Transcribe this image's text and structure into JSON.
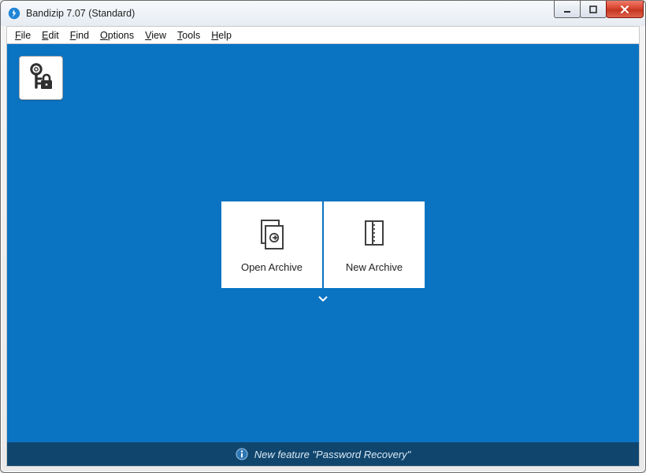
{
  "title": "Bandizip 7.07 (Standard)",
  "menu": {
    "file": {
      "mn": "F",
      "rest": "ile"
    },
    "edit": {
      "mn": "E",
      "rest": "dit"
    },
    "find": {
      "mn": "F",
      "rest": "ind"
    },
    "options": {
      "mn": "O",
      "rest": "ptions"
    },
    "view": {
      "mn": "V",
      "rest": "iew"
    },
    "tools": {
      "mn": "T",
      "rest": "ools"
    },
    "help": {
      "mn": "H",
      "rest": "elp"
    }
  },
  "tiles": {
    "open": "Open Archive",
    "new": "New Archive"
  },
  "status": {
    "text": "New feature \"Password Recovery\""
  },
  "colors": {
    "accent": "#0a73c2",
    "statusbar": "#10466e",
    "close": "#cc4b33"
  }
}
